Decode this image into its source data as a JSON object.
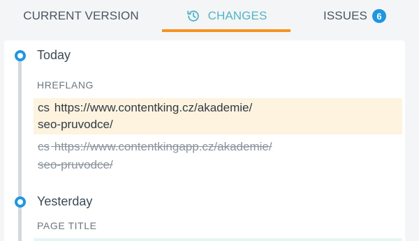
{
  "tabs": {
    "current_version": "CURRENT VERSION",
    "changes": "CHANGES",
    "issues": "ISSUES",
    "issues_count": "6"
  },
  "colors": {
    "accent_tab": "#4fb5c4",
    "underline": "#f7931e",
    "badge": "#1f97e0",
    "highlight_new": "#fdf3df"
  },
  "icons": {
    "changes_tab": "history-icon"
  },
  "timeline": {
    "today": {
      "day": "Today",
      "field": "HREFLANG",
      "new_lang": "cs",
      "new_url_line1": "https://www.contentking.cz/akademie/",
      "new_url_line2": "seo-pruvodce/",
      "old_lang": "cs",
      "old_url_line1": "https://www.contentkingapp.cz/akademie/",
      "old_url_line2": "seo-pruvodce/"
    },
    "yesterday": {
      "day": "Yesterday",
      "field": "PAGE TITLE"
    }
  }
}
